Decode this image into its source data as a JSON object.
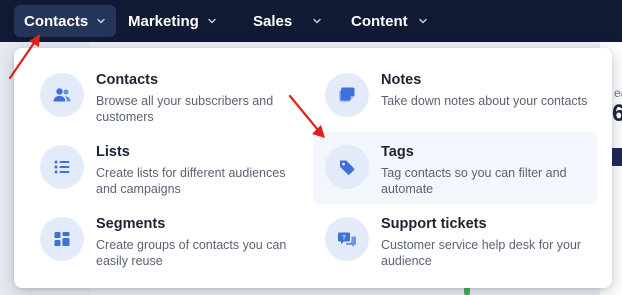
{
  "nav": {
    "items": [
      {
        "label": "Contacts",
        "active": true
      },
      {
        "label": "Marketing",
        "active": false
      },
      {
        "label": "Sales",
        "active": false
      },
      {
        "label": "Content",
        "active": false
      }
    ]
  },
  "background": {
    "text_partial": "ea",
    "number_partial": "6"
  },
  "dropdown": {
    "items": [
      {
        "title": "Contacts",
        "description": "Browse all your subscribers and customers",
        "icon": "people-icon"
      },
      {
        "title": "Notes",
        "description": "Take down notes about your contacts",
        "icon": "notes-icon"
      },
      {
        "title": "Lists",
        "description": "Create lists for different audiences and campaigns",
        "icon": "list-icon"
      },
      {
        "title": "Tags",
        "description": "Tag contacts so you can filter and automate",
        "icon": "tag-icon"
      },
      {
        "title": "Segments",
        "description": "Create groups of contacts you can easily reuse",
        "icon": "segments-icon"
      },
      {
        "title": "Support tickets",
        "description": "Customer service help desk for your audience",
        "icon": "support-tickets-icon"
      }
    ]
  },
  "colors": {
    "topbar": "#111a35",
    "active_nav": "#25355a",
    "icon_blue": "#3f6fd8",
    "icon_bg": "#e3ebfa",
    "arrow": "#e0211b"
  }
}
